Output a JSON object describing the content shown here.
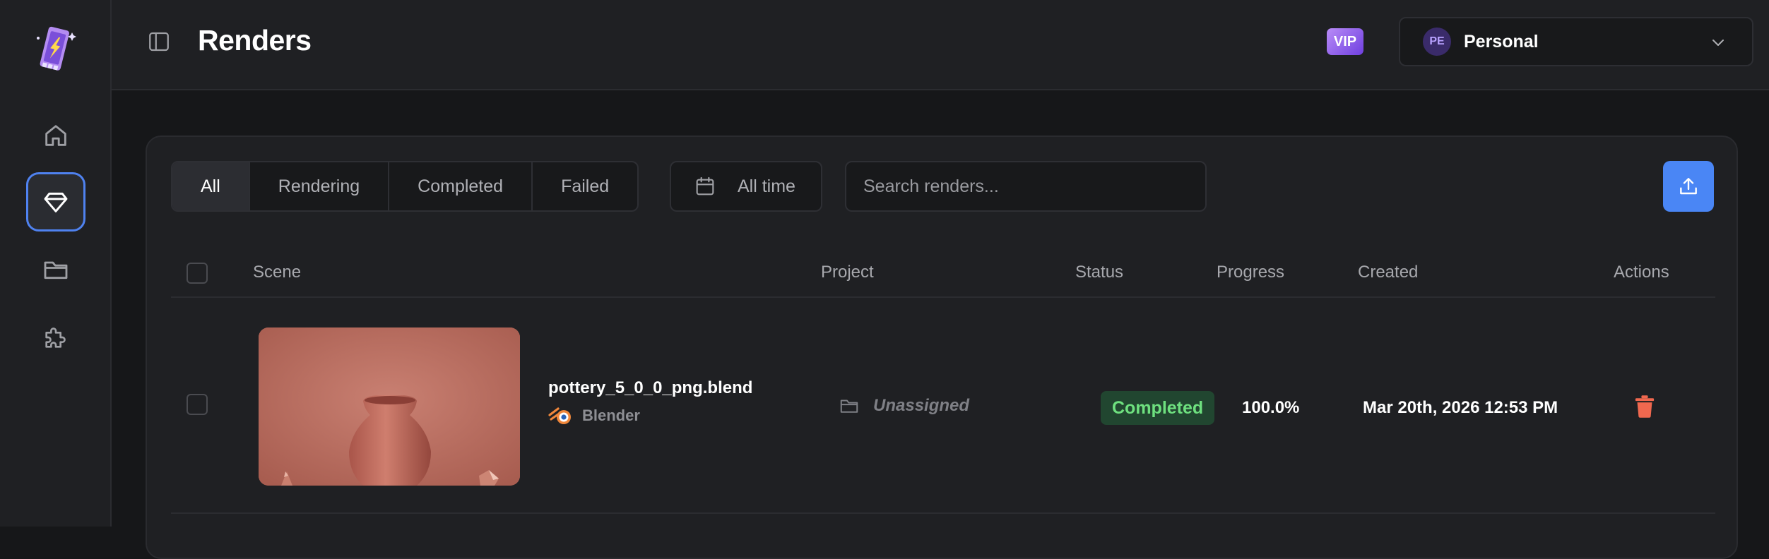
{
  "sidebar": {
    "logo_name": "app-logo",
    "items": [
      {
        "name": "home",
        "icon": "home-icon",
        "active": false
      },
      {
        "name": "renders",
        "icon": "diamond-icon",
        "active": true
      },
      {
        "name": "projects",
        "icon": "folder-icon",
        "active": false
      },
      {
        "name": "plugins",
        "icon": "puzzle-icon",
        "active": false
      }
    ]
  },
  "header": {
    "title": "Renders",
    "vip_label": "VIP",
    "workspace": {
      "avatar_initials": "PE",
      "name": "Personal"
    }
  },
  "filters": {
    "tabs": [
      {
        "label": "All",
        "active": true
      },
      {
        "label": "Rendering",
        "active": false
      },
      {
        "label": "Completed",
        "active": false
      },
      {
        "label": "Failed",
        "active": false
      }
    ],
    "date_range": "All time",
    "search_placeholder": "Search renders..."
  },
  "table": {
    "columns": [
      "Scene",
      "Project",
      "Status",
      "Progress",
      "Created",
      "Actions"
    ],
    "rows": [
      {
        "scene_name": "pottery_5_0_0_png.blend",
        "engine": "Blender",
        "project": "Unassigned",
        "status": "Completed",
        "progress": "100.0%",
        "created": "Mar 20th, 2026 12:53 PM"
      }
    ]
  },
  "colors": {
    "accent": "#4a86f5",
    "status_completed_bg": "#214630",
    "status_completed_text": "#6ee07f",
    "delete": "#f0684f"
  }
}
